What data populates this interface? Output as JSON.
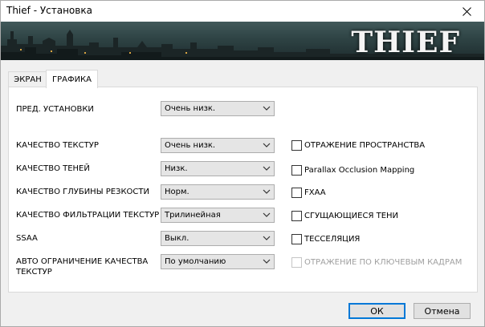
{
  "window": {
    "title": "Thief - Установка"
  },
  "banner": {
    "logo_text": "THIEF"
  },
  "tabs": [
    {
      "label": "ЭКРАН",
      "active": false
    },
    {
      "label": "ГРАФИКА",
      "active": true
    }
  ],
  "settings": [
    {
      "label": "ПРЕД. УСТАНОВКИ",
      "value": "Очень низк."
    },
    {
      "label": "КАЧЕСТВО ТЕКСТУР",
      "value": "Очень низк."
    },
    {
      "label": "КАЧЕСТВО ТЕНЕЙ",
      "value": "Низк."
    },
    {
      "label": "КАЧЕСТВО ГЛУБИНЫ РЕЗКОСТИ",
      "value": "Норм."
    },
    {
      "label": "КАЧЕСТВО ФИЛЬТРАЦИИ ТЕКСТУР",
      "value": "Трилинейная"
    },
    {
      "label": "SSAA",
      "value": "Выкл."
    },
    {
      "label_line1": "АВТО ОГРАНИЧЕНИЕ КАЧЕСТВА",
      "label_line2": "ТЕКСТУР",
      "value": "По умолчанию"
    }
  ],
  "checkboxes": [
    {
      "label": "ОТРАЖЕНИЕ ПРОСТРАНСТВА",
      "checked": false,
      "enabled": true
    },
    {
      "label": "Parallax Occlusion Mapping",
      "checked": false,
      "enabled": true
    },
    {
      "label": "FXAA",
      "checked": false,
      "enabled": true
    },
    {
      "label": "СГУЩАЮЩИЕСЯ ТЕНИ",
      "checked": false,
      "enabled": true
    },
    {
      "label": "ТЕССЕЛЯЦИЯ",
      "checked": false,
      "enabled": true
    },
    {
      "label": "ОТРАЖЕНИЕ ПО КЛЮЧЕВЫМ КАДРАМ",
      "checked": false,
      "enabled": false
    }
  ],
  "buttons": {
    "ok": "ОК",
    "cancel": "Отмена"
  },
  "colors": {
    "default_button_border": "#0078d7",
    "disabled_text": "#a0a0a0",
    "banner_sky": "#41595a"
  }
}
